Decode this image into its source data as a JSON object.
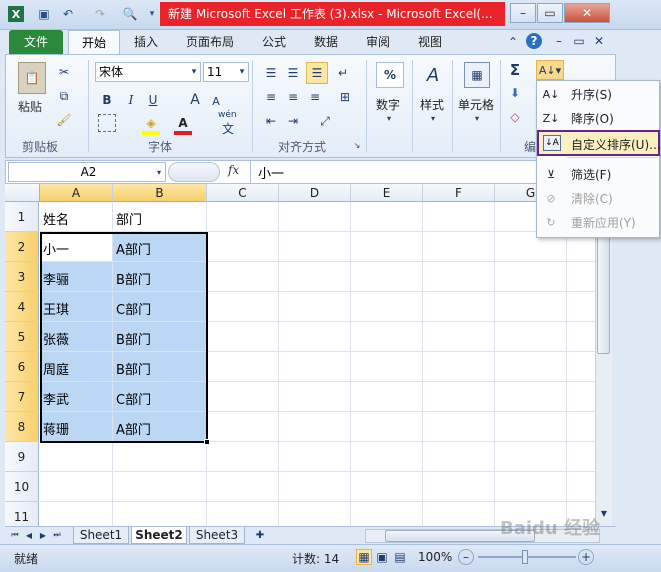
{
  "window": {
    "title": "新建 Microsoft Excel 工作表 (3).xlsx  -  Microsoft Excel(...",
    "controls": {
      "minimize": "–",
      "restore": "▭",
      "close": "✕"
    }
  },
  "ribbon_tabs": [
    "文件",
    "开始",
    "插入",
    "页面布局",
    "公式",
    "数据",
    "审阅",
    "视图"
  ],
  "clipboard": {
    "paste": "粘贴",
    "group": "剪贴板"
  },
  "font": {
    "name": "宋体",
    "size": "11",
    "group": "字体",
    "bold": "B",
    "italic": "I",
    "underline": "U",
    "grow": "A",
    "shrink": "A",
    "color_letter": "A",
    "wen": "wén",
    "wen_char": "文"
  },
  "alignment": {
    "group": "对齐方式"
  },
  "number": {
    "label": "数字",
    "percent": "%"
  },
  "styles": {
    "label": "样式"
  },
  "cells": {
    "label": "单元格"
  },
  "editing": {
    "group": "编",
    "sigma": "Σ"
  },
  "formula_bar": {
    "name_box": "A2",
    "fx": "fx",
    "value": "小一"
  },
  "columns": [
    "A",
    "B",
    "C",
    "D",
    "E",
    "F",
    "G"
  ],
  "rows": [
    {
      "num": "1",
      "a": "姓名",
      "b": "部门"
    },
    {
      "num": "2",
      "a": "小一",
      "b": "A部门"
    },
    {
      "num": "3",
      "a": "李骊",
      "b": "B部门"
    },
    {
      "num": "4",
      "a": "王琪",
      "b": "C部门"
    },
    {
      "num": "5",
      "a": "张薇",
      "b": "B部门"
    },
    {
      "num": "6",
      "a": "周庭",
      "b": "B部门"
    },
    {
      "num": "7",
      "a": "李武",
      "b": "C部门"
    },
    {
      "num": "8",
      "a": "蒋珊",
      "b": "A部门"
    },
    {
      "num": "9",
      "a": "",
      "b": ""
    },
    {
      "num": "10",
      "a": "",
      "b": ""
    },
    {
      "num": "11",
      "a": "",
      "b": ""
    }
  ],
  "sheets": [
    "Sheet1",
    "Sheet2",
    "Sheet3"
  ],
  "status": {
    "ready": "就绪",
    "count": "计数: 14",
    "zoom": "100%"
  },
  "sort_menu": {
    "asc": "升序(S)",
    "desc": "降序(O)",
    "custom": "自定义排序(U)...",
    "filter": "筛选(F)",
    "clear": "清除(C)",
    "reapply": "重新应用(Y)"
  },
  "watermark": "Baidu 经验"
}
